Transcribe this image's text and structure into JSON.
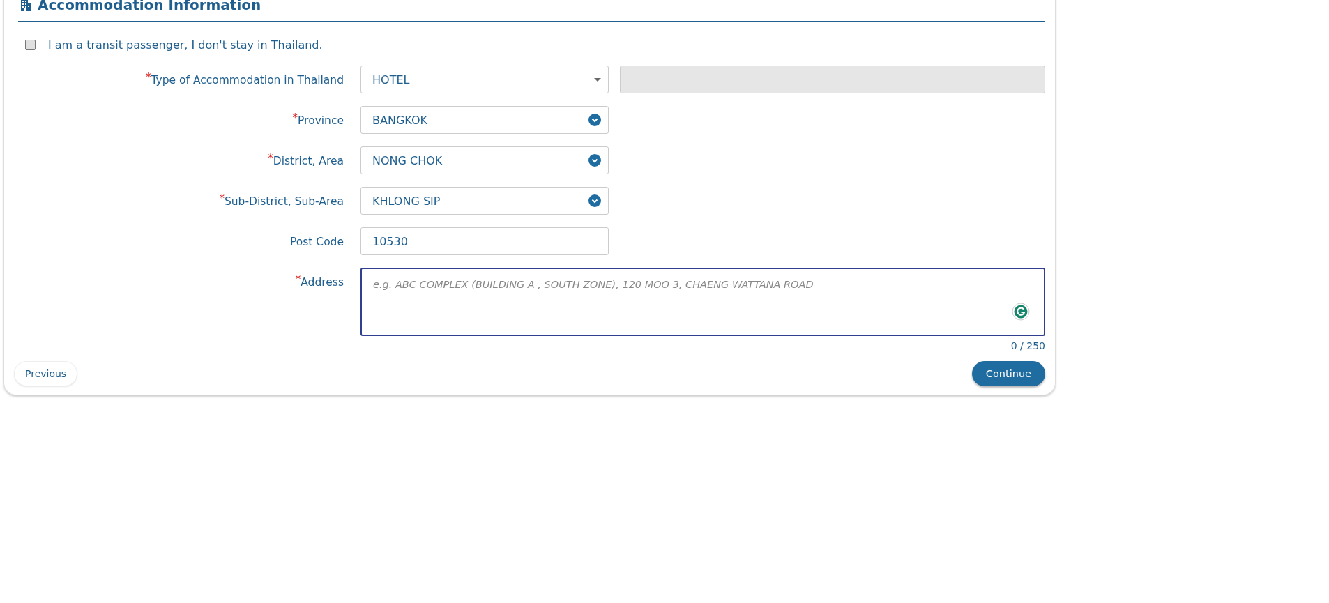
{
  "section": {
    "title": "Accommodation Information"
  },
  "transit": {
    "label": "I am a transit passenger, I don't stay in Thailand.",
    "checked": false
  },
  "fields": [
    {
      "label": "Type of Accommodation in Thailand",
      "marker": "*",
      "kind": "select",
      "value": "HOTEL",
      "extra": {
        "disabled": true
      }
    },
    {
      "label": "Province",
      "marker": "*",
      "kind": "dropdown",
      "value": "BANGKOK"
    },
    {
      "label": "District, Area",
      "marker": "*",
      "kind": "dropdown",
      "value": "NONG CHOK"
    },
    {
      "label": "Sub-District, Sub-Area",
      "marker": "*",
      "kind": "dropdown",
      "value": "KHLONG SIP"
    },
    {
      "label": "Post Code",
      "kind": "text",
      "value": "10530"
    },
    {
      "label": "Address",
      "marker": "*",
      "kind": "textarea",
      "placeholder": "e.g. ABC COMPLEX (BUILDING A , SOUTH ZONE), 120 MOO 3, CHAENG WATTANA ROAD",
      "counter": "0 / 250"
    }
  ],
  "buttons": {
    "previous": "Previous",
    "continue": "Continue"
  }
}
